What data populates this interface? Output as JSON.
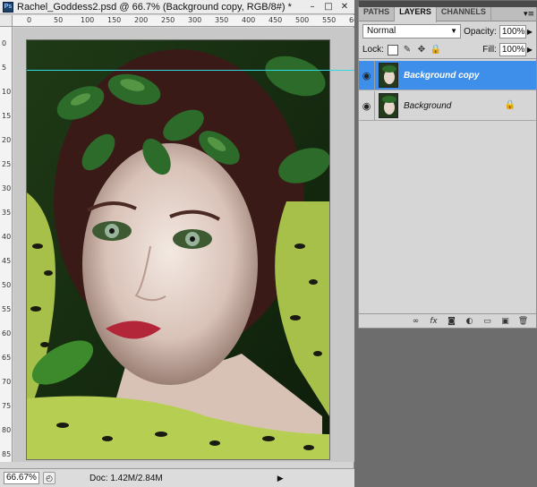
{
  "document": {
    "title": "Rachel_Goddess2.psd @ 66.7% (Background copy, RGB/8#) *",
    "app_badge": "Ps",
    "window_buttons": [
      "–",
      "□",
      "✕"
    ],
    "ruler_h_labels": [
      "0",
      "50",
      "100",
      "150",
      "200",
      "250",
      "300",
      "350",
      "400",
      "450",
      "500",
      "550",
      "600"
    ],
    "ruler_v_labels": [
      "0",
      "5",
      "10",
      "15",
      "20",
      "25",
      "30",
      "35",
      "40",
      "45",
      "50",
      "55",
      "60",
      "65",
      "70",
      "75",
      "80",
      "85"
    ],
    "zoom": "66.67%",
    "doc_size": "Doc: 1.42M/2.84M"
  },
  "layers_panel": {
    "tabs": [
      "PATHS",
      "LAYERS",
      "CHANNELS"
    ],
    "active_tab": "LAYERS",
    "blend_mode": "Normal",
    "opacity_label": "Opacity:",
    "opacity": "100%",
    "lock_label": "Lock:",
    "fill_label": "Fill:",
    "fill": "100%",
    "layers": [
      {
        "name": "Background copy",
        "selected": true,
        "locked": false
      },
      {
        "name": "Background",
        "selected": false,
        "locked": true
      }
    ],
    "footer_icons": [
      "link-icon",
      "fx-icon",
      "mask-icon",
      "adjustment-icon",
      "group-icon",
      "new-layer-icon",
      "trash-icon"
    ]
  },
  "colors": {
    "selection": "#3d8fe9",
    "guide": "#31d7e2"
  }
}
